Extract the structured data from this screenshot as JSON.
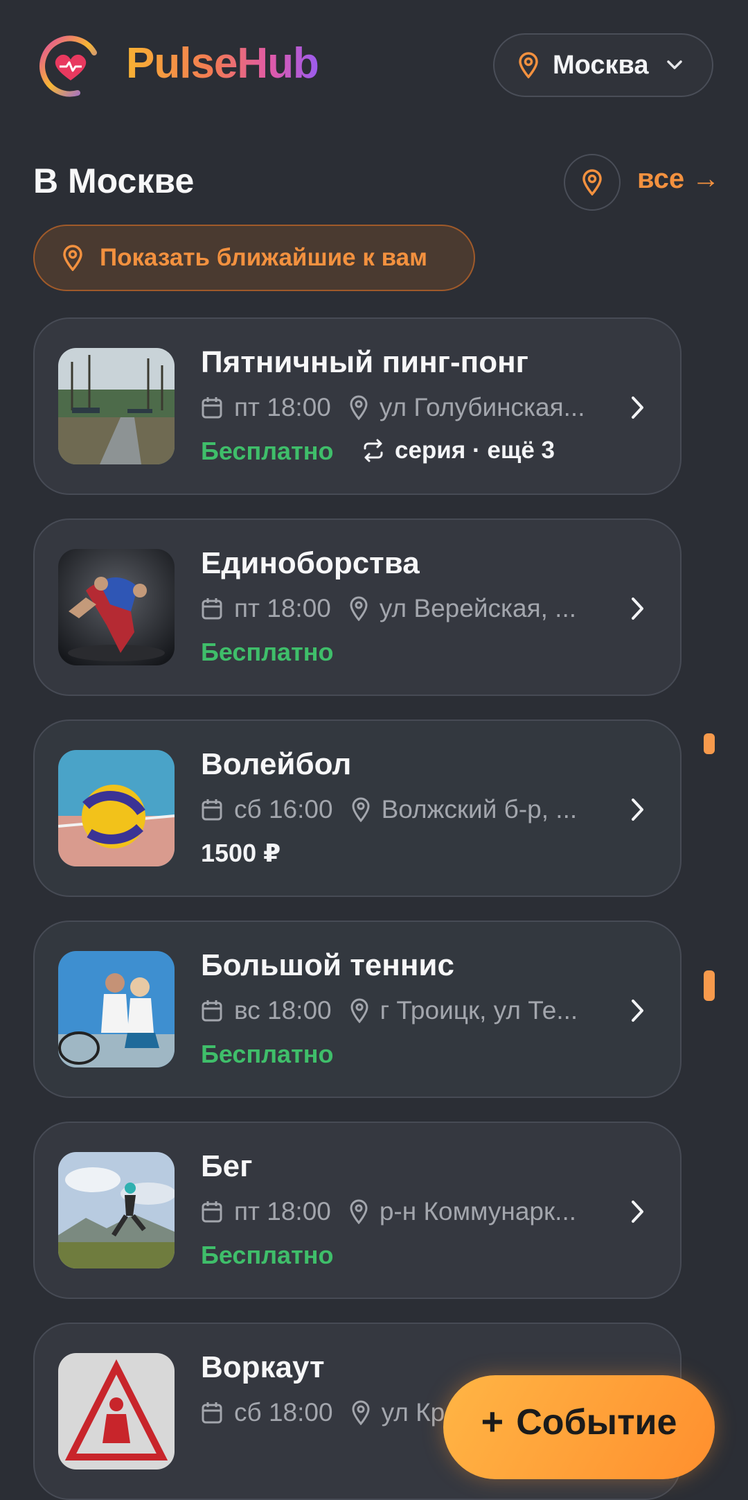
{
  "header": {
    "brand": "PulseHub",
    "city_selector": {
      "icon": "map-pin-icon",
      "label": "Москва",
      "chevron": "chevron-down-icon"
    }
  },
  "section": {
    "title": "В Москве",
    "location_icon": "map-pin-icon",
    "all_link": "все →"
  },
  "nearby_button": {
    "icon": "map-pin-icon",
    "label": "Показать ближайшие к вам"
  },
  "events": [
    {
      "title": "Пятничный пинг-понг",
      "time": "пт 18:00",
      "address": "ул Голубинская...",
      "price": "Бесплатно",
      "price_type": "free",
      "series": "серия · ещё 3",
      "image": "park-courts"
    },
    {
      "title": "Единоборства",
      "time": "пт 18:00",
      "address": "ул Верейская, ...",
      "price": "Бесплатно",
      "price_type": "free",
      "image": "wrestlers"
    },
    {
      "title": "Волейбол",
      "time": "сб 16:00",
      "address": "Волжский б-р, ...",
      "price": "1500 ₽",
      "price_type": "paid",
      "image": "volleyball"
    },
    {
      "title": "Большой теннис",
      "time": "вс 18:00",
      "address": "г Троицк, ул Те...",
      "price": "Бесплатно",
      "price_type": "free",
      "image": "tennis-players"
    },
    {
      "title": "Бег",
      "time": "пт 18:00",
      "address": "р-н Коммунарк...",
      "price": "Бесплатно",
      "price_type": "free",
      "image": "runner"
    },
    {
      "title": "Воркаут",
      "time": "сб 18:00",
      "address": "ул Кр...",
      "price": "",
      "price_type": "free",
      "image": "workout-sign"
    }
  ],
  "fab": {
    "icon": "plus-icon",
    "label": "Событие"
  },
  "colors": {
    "accent": "#f3913f",
    "free": "#3fbe6a",
    "background": "#2b2e35",
    "card": "#353840"
  }
}
